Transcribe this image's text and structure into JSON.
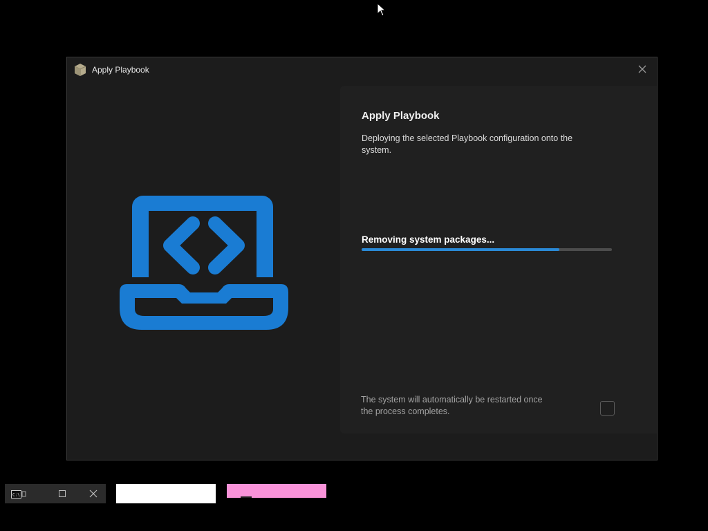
{
  "window": {
    "title": "Apply Playbook",
    "app_icon": "package-box-icon",
    "close_icon": "close-icon"
  },
  "illustration": {
    "icon": "laptop-code-icon",
    "color": "#1a7cd3"
  },
  "panel": {
    "heading": "Apply Playbook",
    "description": "Deploying the selected Playbook configuration onto the system.",
    "status": "Removing system packages...",
    "progress_fraction": 0.79,
    "restart_note": "The system will automatically be restarted once the process completes."
  },
  "taskbar": {
    "console_icon": "command-prompt-icon",
    "maximize_icon": "maximize-icon",
    "close_icon": "close-icon"
  },
  "colors": {
    "accent": "#2a89d6",
    "pink_tile": "#f993d9"
  }
}
